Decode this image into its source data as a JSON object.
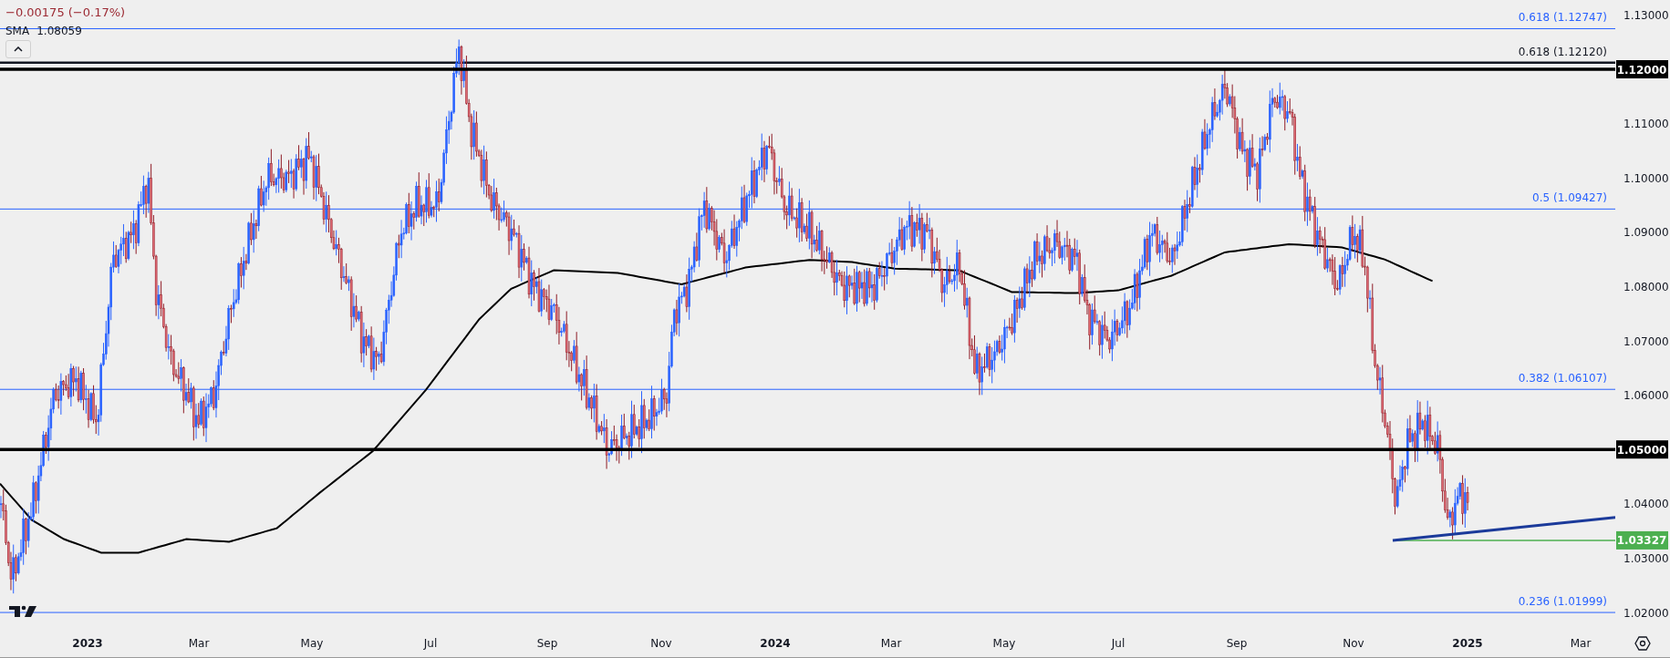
{
  "legend": {
    "change": "−0.00175 (−0.17%)",
    "indicator": "SMA",
    "indicator_value": "1.08059"
  },
  "fib_levels": [
    {
      "label": "0.618 (1.12747)",
      "color": "#2962ff"
    },
    {
      "label": "0.618 (1.12120)",
      "color": "#131722"
    },
    {
      "label": "0.5 (1.09427)",
      "color": "#2962ff"
    },
    {
      "label": "0.382 (1.06107)",
      "color": "#2962ff"
    },
    {
      "label": "0.236 (1.01999)",
      "color": "#2962ff"
    }
  ],
  "price_lines": [
    {
      "badge": "1.12000",
      "color": "#000000"
    },
    {
      "badge": "1.05000",
      "color": "#000000"
    },
    {
      "badge": "1.03327",
      "color": "#4caf50"
    }
  ],
  "price_ticks": [
    "1.13000",
    "1.11000",
    "1.10000",
    "1.09000",
    "1.08000",
    "1.07000",
    "1.06000",
    "1.04000",
    "1.03000",
    "1.02000"
  ],
  "time_ticks": [
    {
      "label": "2023",
      "major": true
    },
    {
      "label": "Mar",
      "major": false
    },
    {
      "label": "May",
      "major": false
    },
    {
      "label": "Jul",
      "major": false
    },
    {
      "label": "Sep",
      "major": false
    },
    {
      "label": "Nov",
      "major": false
    },
    {
      "label": "2024",
      "major": true
    },
    {
      "label": "Mar",
      "major": false
    },
    {
      "label": "May",
      "major": false
    },
    {
      "label": "Jul",
      "major": false
    },
    {
      "label": "Sep",
      "major": false
    },
    {
      "label": "Nov",
      "major": false
    },
    {
      "label": "2025",
      "major": true
    },
    {
      "label": "Mar",
      "major": false
    }
  ]
}
